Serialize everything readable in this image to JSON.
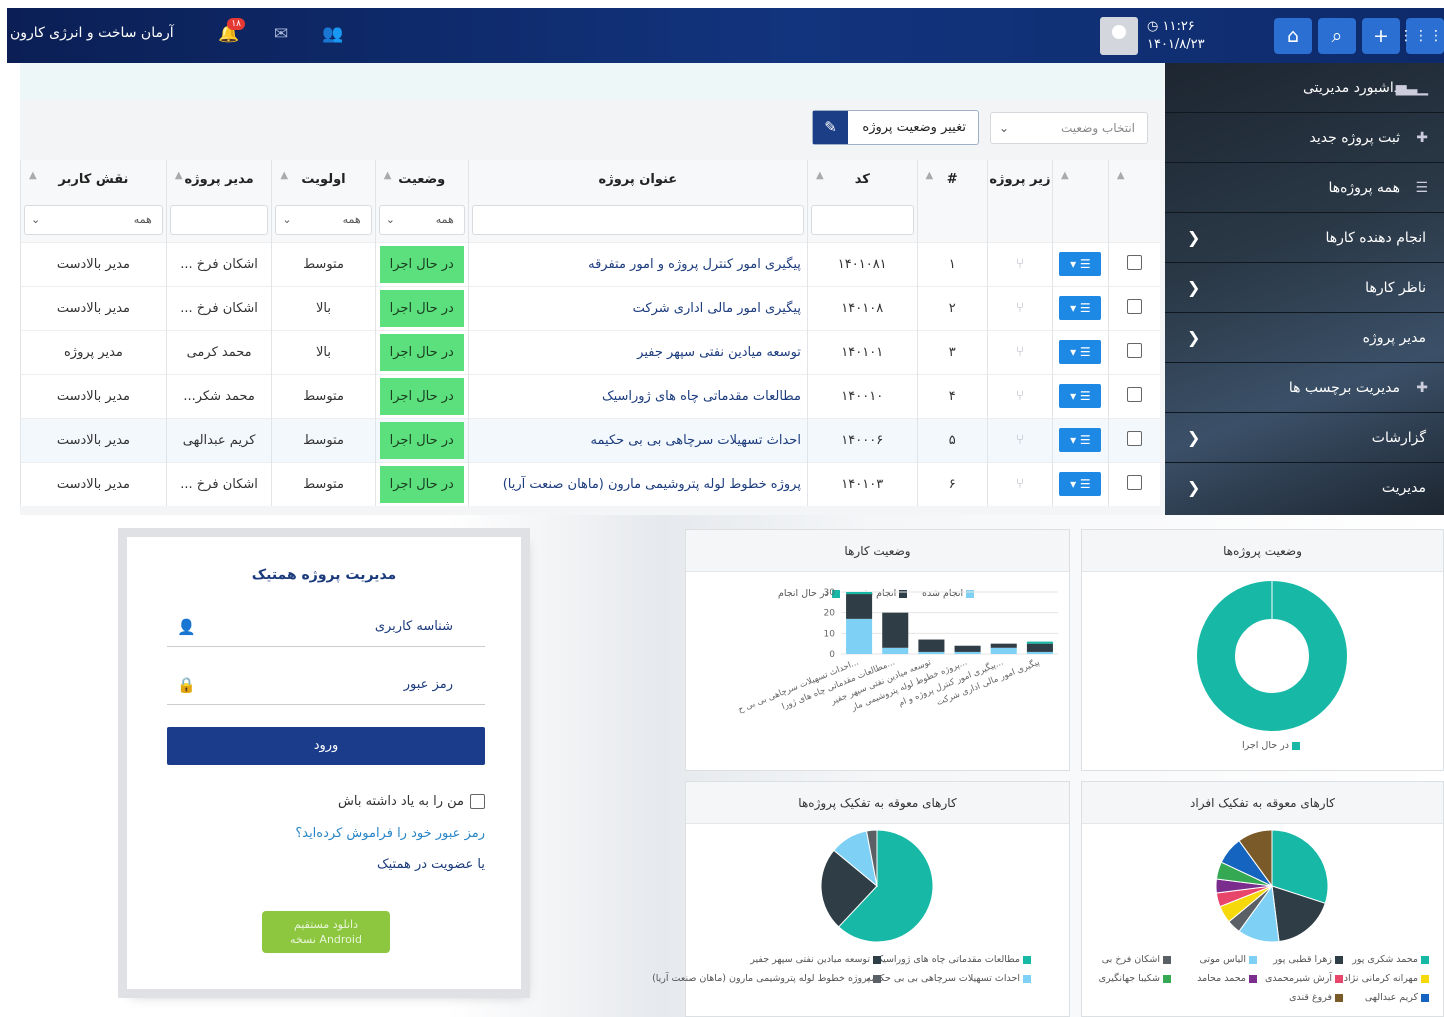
{
  "topbar": {
    "brand": "آرمان ساخت و انرژی کارون",
    "notif_count": "۱۸",
    "time": "۱۱:۲۶",
    "date": "۱۴۰۱/۸/۲۳"
  },
  "sidebar": {
    "items": [
      {
        "label": "داشبورد مدیریتی",
        "icon": "chart-icon"
      },
      {
        "label": "ثبت پروژه جدید",
        "icon": "plus-icon"
      },
      {
        "label": "همه پروژه‌ها",
        "icon": "list-icon"
      },
      {
        "label": "انجام دهنده کارها",
        "icon": "chevron-left-icon"
      },
      {
        "label": "ناظر کارها",
        "icon": "chevron-left-icon"
      },
      {
        "label": "مدیر پروژه",
        "icon": "chevron-left-icon"
      },
      {
        "label": "مدیریت برچسب ها",
        "icon": "plus-icon"
      },
      {
        "label": "گزارشات",
        "icon": "chevron-left-icon"
      },
      {
        "label": "مدیریت",
        "icon": "chevron-left-icon"
      }
    ]
  },
  "toolbar": {
    "status_select_placeholder": "انتخاب وضعیت",
    "change_status_label": "تغییر وضعیت پروژه"
  },
  "table": {
    "headers": {
      "subproject": "زیر پروژه",
      "num": "#",
      "code": "کد",
      "title": "عنوان پروژه",
      "status": "وضعیت",
      "priority": "اولویت",
      "manager": "مدیر پروژه",
      "role": "نقش کاربر"
    },
    "filter_all": "همه",
    "rows": [
      {
        "num": "۱",
        "code": "۱۴۰۱۰۸۱",
        "title": "پیگیری امور کنترل پروژه و امور متفرقه",
        "status": "در حال اجرا",
        "priority": "متوسط",
        "manager": "اشکان فرخ ...",
        "role": "مدیر بالادست"
      },
      {
        "num": "۲",
        "code": "۱۴۰۱۰۸",
        "title": "پیگیری امور مالی اداری شرکت",
        "status": "در حال اجرا",
        "priority": "بالا",
        "manager": "اشکان فرخ ...",
        "role": "مدیر بالادست"
      },
      {
        "num": "۳",
        "code": "۱۴۰۱۰۱",
        "title": "توسعه میادین نفتی سپهر جفیر",
        "status": "در حال اجرا",
        "priority": "بالا",
        "manager": "محمد کرمی",
        "role": "مدیر پروژه"
      },
      {
        "num": "۴",
        "code": "۱۴۰۰۱۰",
        "title": "مطالعات مقدماتی چاه های ژوراسیک",
        "status": "در حال اجرا",
        "priority": "متوسط",
        "manager": "محمد شکر...",
        "role": "مدیر بالادست"
      },
      {
        "num": "۵",
        "code": "۱۴۰۰۰۶",
        "title": "احداث تسهیلات سرچاهی بی بی حکیمه",
        "status": "در حال اجرا",
        "priority": "متوسط",
        "manager": "کریم عبدالهی",
        "role": "مدیر بالادست"
      },
      {
        "num": "۶",
        "code": "۱۴۰۱۰۳",
        "title": "پروژه خطوط لوله پتروشیمی مارون (ماهان صنعت آریا)",
        "status": "در حال اجرا",
        "priority": "متوسط",
        "manager": "اشکان فرخ ...",
        "role": "مدیر بالادست"
      }
    ]
  },
  "login": {
    "title": "مدیریت پروژه همتیک",
    "username_placeholder": "شناسه کاربری",
    "password_placeholder": "رمز عبور",
    "submit": "ورود",
    "remember": "من را به یاد داشته باش",
    "forgot": "رمز عبور خود را فراموش کرده‌اید؟",
    "register": "یا عضویت در همتیک",
    "android_line1": "دانلود مستقیم",
    "android_line2": "نسخه Android"
  },
  "panels": {
    "project_status": "وضعیت پروژه‌ها",
    "task_status": "وضعیت کارها",
    "overdue_people": "کارهای معوقه به تفکیک افراد",
    "overdue_projects": "کارهای معوقه به تفکیک پروژه‌ها"
  },
  "colors": {
    "teal": "#17b8a6",
    "dark": "#2f3e46",
    "light_blue": "#7fd0f5",
    "status_green": "#5be07d",
    "navy": "#1a3c8a"
  },
  "chart_data": [
    {
      "type": "pie",
      "title": "وضعیت پروژه‌ها",
      "series": [
        {
          "name": "در حال اجرا",
          "values": [
            6
          ]
        }
      ],
      "legend": [
        "در حال اجرا"
      ]
    },
    {
      "type": "bar",
      "title": "وضعیت کارها",
      "legend": [
        "انجام شده",
        "انجام نشده",
        "در حال انجام"
      ],
      "categories": [
        "احداث تسهیلات سرچاهی بی بی حکیمه",
        "مطالعات مقدماتی چاه های ژوراسیک",
        "توسعه میادین نفتی سپهر جفیر",
        "پروژه خطوط لوله پتروشیمی مارون (ماهان صنعت آریا)",
        "پیگیری امور کنترل پروژه و امور متفرقه",
        "پیگیری امور مالی اداری شرکت"
      ],
      "ylim": [
        0,
        30
      ],
      "yticks": [
        "0",
        "10",
        "20",
        "30"
      ],
      "series": [
        {
          "name": "انجام شده",
          "values": [
            17,
            3,
            1,
            1,
            3,
            1
          ]
        },
        {
          "name": "انجام نشده",
          "values": [
            12,
            17,
            6,
            3,
            2,
            4
          ]
        },
        {
          "name": "در حال انجام",
          "values": [
            1,
            0,
            0,
            0,
            0,
            1
          ]
        }
      ]
    },
    {
      "type": "pie",
      "title": "کارهای معوقه به تفکیک افراد",
      "legend": [
        "محمد شکری پور",
        "زهرا قطبی پور",
        "الیاس موتی",
        "اشکان فرخ بی",
        "مهرانه کرمانی نژاد",
        "آرش شیرمحمدی",
        "محمد محامد",
        "شکیبا جهانگیری",
        "کریم عبدالهی",
        "فروغ قندی"
      ],
      "values": [
        30,
        18,
        12,
        4,
        5,
        4,
        4,
        5,
        8,
        10
      ]
    },
    {
      "type": "pie",
      "title": "کارهای معوقه به تفکیک پروژه‌ها",
      "legend": [
        "مطالعات مقدماتی چاه های ژوراسیک",
        "توسعه میادین نفتی سپهر جفیر",
        "احداث تسهیلات سرچاهی بی بی حکیمه",
        "پروژه خطوط لوله پتروشیمی مارون (ماهان صنعت آریا)"
      ],
      "values": [
        62,
        24,
        11,
        3
      ]
    }
  ]
}
